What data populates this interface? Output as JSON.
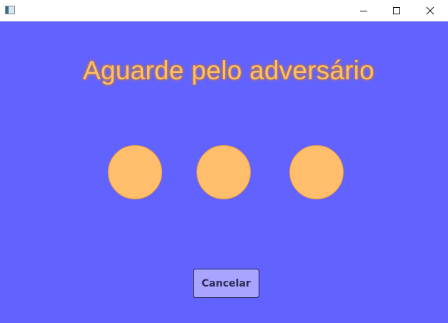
{
  "window": {
    "title": "",
    "controls": {
      "minimize_icon": "minimize-icon",
      "maximize_icon": "maximize-icon",
      "close_icon": "close-icon"
    }
  },
  "main": {
    "heading": "Aguarde pelo adversário",
    "loading_dots": [
      "dot",
      "dot",
      "dot"
    ],
    "cancel_label": "Cancelar"
  },
  "colors": {
    "background": "#6262ff",
    "heading_text": "#ffbe68",
    "dot_fill": "#ffbe6c",
    "button_fill": "#a8a4ff",
    "button_text": "#2d2d55"
  }
}
